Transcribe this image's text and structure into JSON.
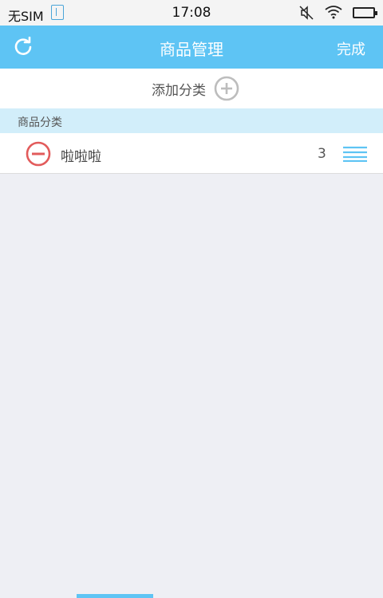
{
  "status_bar": {
    "carrier": "无SIM",
    "time": "17:08"
  },
  "nav": {
    "title": "商品管理",
    "done_label": "完成",
    "left_icon": "refresh-icon"
  },
  "add_category": {
    "label": "添加分类",
    "icon": "plus-circle-icon"
  },
  "section": {
    "title": "商品分类"
  },
  "categories": [
    {
      "name": "啦啦啦",
      "count": "3"
    }
  ],
  "colors": {
    "accent": "#5ec4f4",
    "section_bg": "#d2eefa",
    "delete_red": "#e25b5b",
    "page_bg": "#eeeff4"
  }
}
